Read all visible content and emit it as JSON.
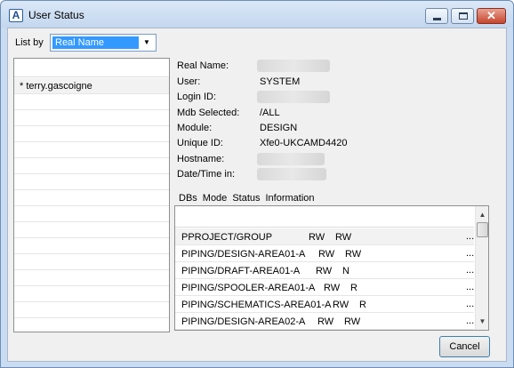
{
  "window": {
    "title": "User Status",
    "app_icon_letter": "A",
    "close_glyph": "✕"
  },
  "listby": {
    "label": "List by",
    "selected": "Real Name",
    "arrow": "▼"
  },
  "users": [
    "* terry.gascoigne"
  ],
  "details": [
    {
      "label": "Real Name:",
      "value": ""
    },
    {
      "label": "User:",
      "value": "SYSTEM"
    },
    {
      "label": "Login ID:",
      "value": ""
    },
    {
      "label": "Mdb Selected:",
      "value": "/ALL"
    },
    {
      "label": "Module:",
      "value": "DESIGN"
    },
    {
      "label": "Unique ID:",
      "value": "Xfe0-UKCAMD4420"
    },
    {
      "label": "Hostname:",
      "value": ""
    },
    {
      "label": "Date/Time in:",
      "value": ""
    }
  ],
  "dbs": {
    "columns": [
      "DBs",
      "Mode",
      "Status",
      "Information"
    ],
    "rows": [
      {
        "name": "PPROJECT/GROUP",
        "mode": "RW",
        "status": "RW",
        "more": "..."
      },
      {
        "name": "PIPING/DESIGN-AREA01-A",
        "mode": "RW",
        "status": "RW",
        "more": "..."
      },
      {
        "name": "PIPING/DRAFT-AREA01-A",
        "mode": "RW",
        "status": "N",
        "more": "..."
      },
      {
        "name": "PIPING/SPOOLER-AREA01-A",
        "mode": "RW",
        "status": "R",
        "more": "..."
      },
      {
        "name": "PIPING/SCHEMATICS-AREA01-A",
        "mode": "RW",
        "status": "R",
        "more": "..."
      },
      {
        "name": "PIPING/DESIGN-AREA02-A",
        "mode": "RW",
        "status": "RW",
        "more": "..."
      }
    ],
    "scroll_up": "▲",
    "scroll_down": "▼"
  },
  "buttons": {
    "cancel": "Cancel"
  }
}
